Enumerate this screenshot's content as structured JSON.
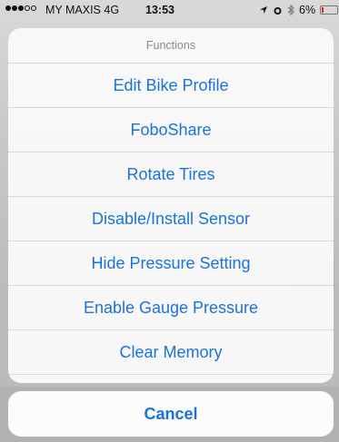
{
  "status_bar": {
    "carrier": "MY MAXIS",
    "network": "4G",
    "time": "13:53",
    "battery": "6%"
  },
  "action_sheet": {
    "title": "Functions",
    "actions": [
      {
        "label": "Edit Bike Profile"
      },
      {
        "label": "FoboShare"
      },
      {
        "label": "Rotate Tires"
      },
      {
        "label": "Disable/Install Sensor"
      },
      {
        "label": "Hide Pressure Setting"
      },
      {
        "label": "Enable Gauge Pressure"
      },
      {
        "label": "Clear Memory"
      }
    ],
    "cancel_label": "Cancel"
  },
  "colors": {
    "action_text": "#1a73d9",
    "title_text": "#8a8a8a",
    "sheet_background": "#fafafa",
    "separator": "#d7d7d7",
    "battery_low": "#e02020"
  },
  "icons": [
    "signal-strength-icon",
    "location-arrow-icon",
    "alarm-icon",
    "bluetooth-icon",
    "battery-icon"
  ]
}
